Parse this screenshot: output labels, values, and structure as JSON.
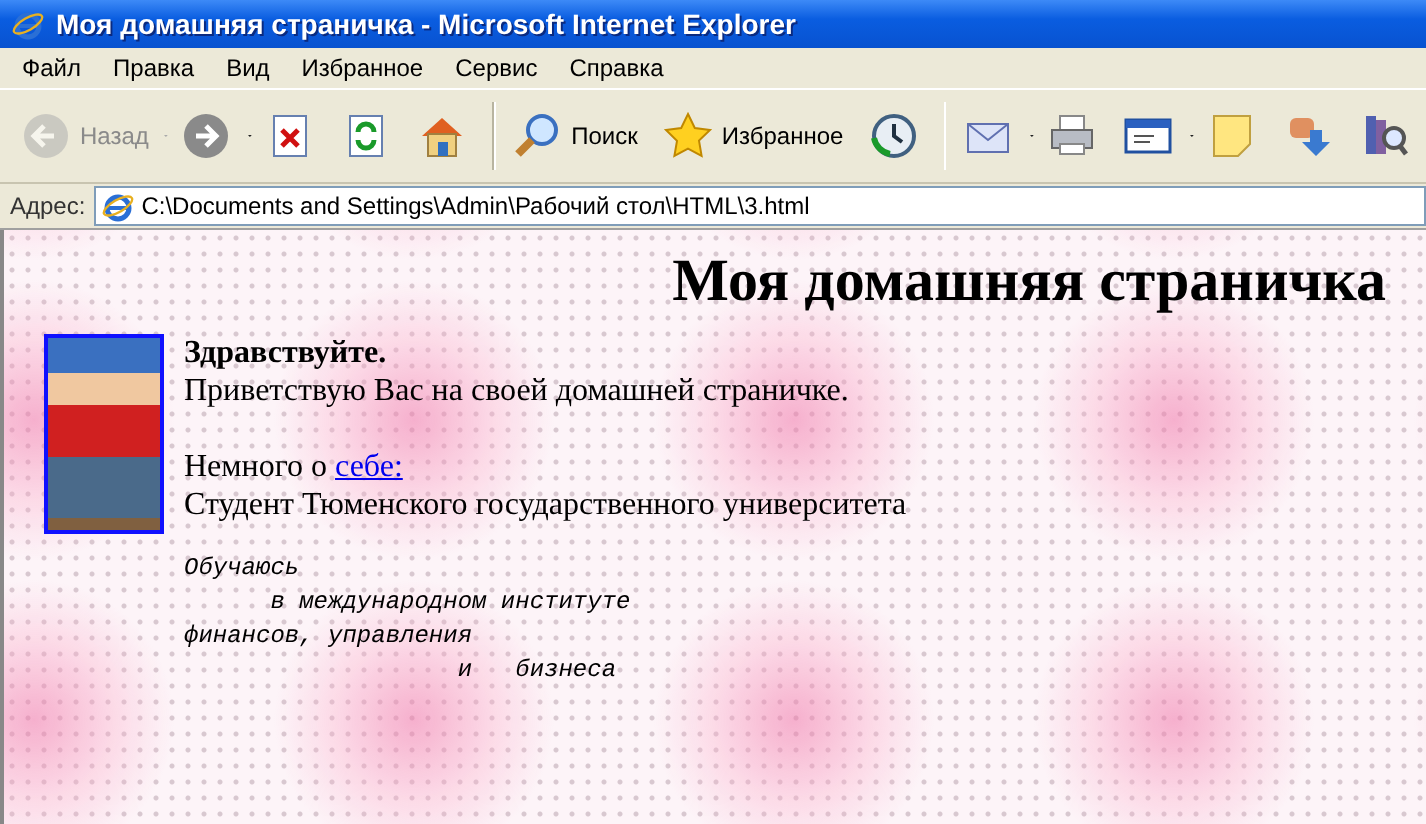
{
  "window": {
    "title": "Моя домашняя страничка - Microsoft Internet Explorer"
  },
  "menu": [
    "Файл",
    "Правка",
    "Вид",
    "Избранное",
    "Сервис",
    "Справка"
  ],
  "toolbar": [
    {
      "kind": "back",
      "label": "Назад",
      "disabled": true,
      "dropdown": true
    },
    {
      "kind": "forward",
      "disabled": false,
      "dropdown": true
    },
    {
      "kind": "stop",
      "disabled": false,
      "dropdown": false
    },
    {
      "kind": "refresh",
      "disabled": false,
      "dropdown": false
    },
    {
      "kind": "home",
      "disabled": false,
      "dropdown": false
    },
    {
      "kind": "separator"
    },
    {
      "kind": "search",
      "label": "Поиск",
      "disabled": false,
      "dropdown": false
    },
    {
      "kind": "favorites",
      "label": "Избранное",
      "disabled": false,
      "dropdown": false
    },
    {
      "kind": "history",
      "disabled": false,
      "dropdown": false
    },
    {
      "kind": "separator"
    },
    {
      "kind": "mail",
      "disabled": false,
      "dropdown": true
    },
    {
      "kind": "print",
      "disabled": false,
      "dropdown": false
    },
    {
      "kind": "edit",
      "disabled": false,
      "dropdown": true
    },
    {
      "kind": "note",
      "disabled": false,
      "dropdown": false
    },
    {
      "kind": "messenger",
      "disabled": false,
      "dropdown": false
    },
    {
      "kind": "research",
      "disabled": false,
      "dropdown": false
    }
  ],
  "address": {
    "label": "Адрес:",
    "value": "C:\\Documents and Settings\\Admin\\Рабочий стол\\HTML\\3.html"
  },
  "page": {
    "heading": "Моя домашняя страничка",
    "greeting": "Здравствуйте.",
    "welcome": "Приветствую Вас на своей домашней страничке.",
    "about_prefix": "Немного о ",
    "about_link": "себе:",
    "student": "Студент Тюменского государственного университета",
    "study": "Обучаюсь\n      в международном институте\nфинансов, управления\n                   и   бизнеса"
  }
}
